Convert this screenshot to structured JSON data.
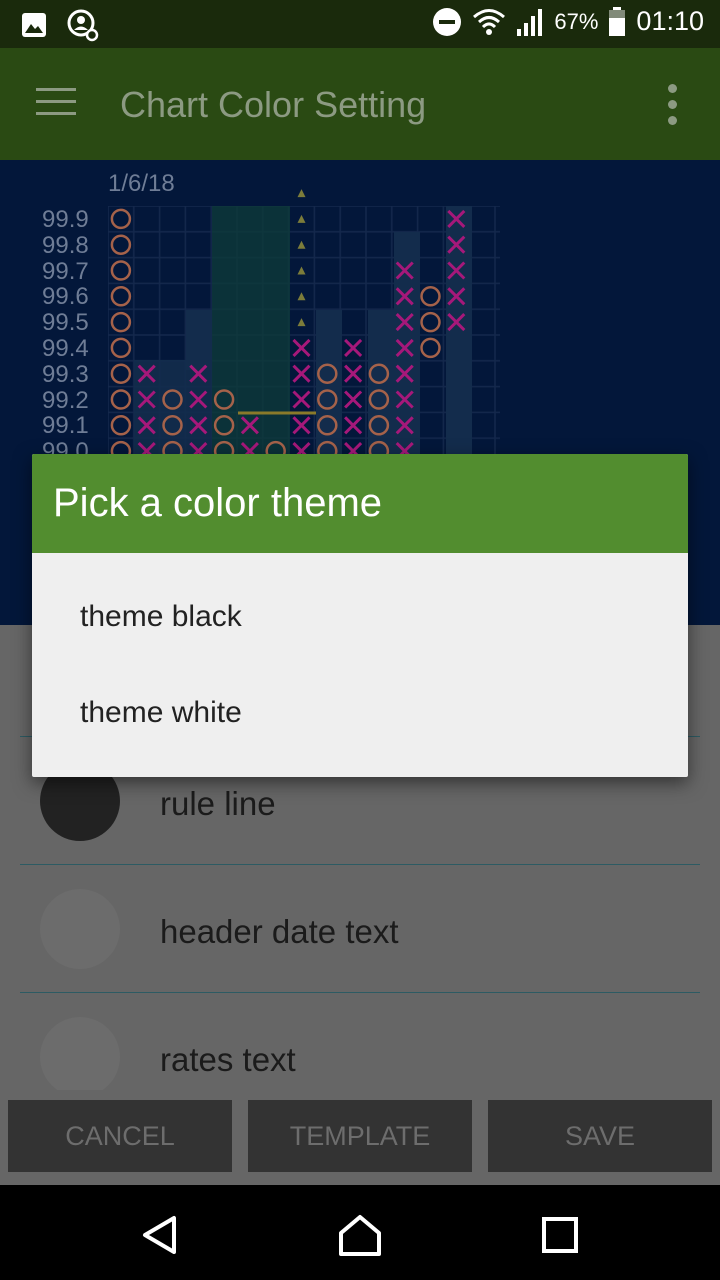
{
  "status_bar": {
    "battery_percent": "67%",
    "clock": "01:10",
    "icons": [
      "image-icon",
      "settings-sync-icon",
      "do-not-disturb-icon",
      "wifi-icon",
      "signal-icon",
      "battery-icon"
    ]
  },
  "app_bar": {
    "title": "Chart Color Setting",
    "icons": [
      "menu-icon",
      "more-vert-icon"
    ]
  },
  "chart": {
    "date_label": "1/6/18",
    "price_labels": [
      "99.9",
      "99.8",
      "99.7",
      "99.6",
      "99.5",
      "99.4",
      "99.3",
      "99.2",
      "99.1",
      "99.0"
    ]
  },
  "settings": {
    "items": [
      {
        "label": "rule line",
        "color": "#222222"
      },
      {
        "label": "header date text",
        "color": "#6c6c6c"
      },
      {
        "label": "rates text",
        "color": "#6c6c6c"
      }
    ]
  },
  "buttons": {
    "cancel": "CANCEL",
    "template": "TEMPLATE",
    "save": "SAVE"
  },
  "dialog": {
    "title": "Pick a color theme",
    "options": [
      "theme black",
      "theme white"
    ]
  },
  "colors": {
    "dialog_header": "#528d2f",
    "app_bar": "#2a4a13",
    "chart_bg": "#03173a",
    "x_mark": "#a6187a",
    "o_mark": "#a5624a"
  },
  "nav_bar": {
    "icons": [
      "back-icon",
      "home-icon",
      "recents-icon"
    ]
  }
}
